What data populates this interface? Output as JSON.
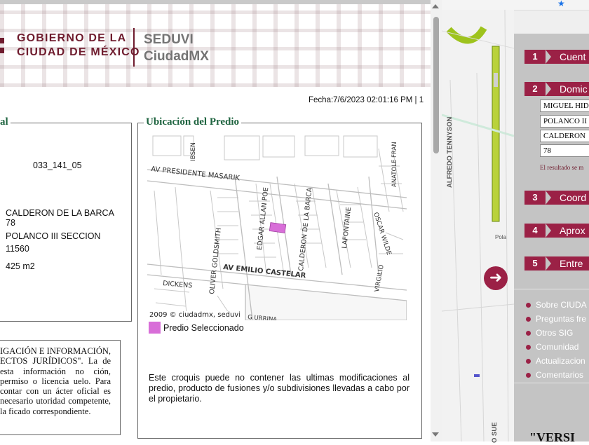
{
  "popup": {
    "header": {
      "gov_line1": "GOBIERNO DE LA",
      "gov_line2": "CIUDAD DE MÉXICO",
      "seduvi_line1": "SEDUVI",
      "seduvi_line2": "CiudadMX"
    },
    "fecha": "Fecha:7/6/2023 02:01:16 PM | 1",
    "left_section": {
      "legend": "al",
      "cuenta_catastral": "033_141_05",
      "calle": "CALDERON DE LA BARCA",
      "numero": "78",
      "colonia": "POLANCO III SECCION",
      "codigo_postal": "11560",
      "superficie": "425 m2",
      "legal_text": "IGACIÓN E INFORMACIÓN, ECTOS JURÍDICOS\". La de esta información no ción, permiso o licencia uelo. Para contar con un ácter oficial es necesario utoridad competente, la ficado correspondiente."
    },
    "right_section": {
      "legend": "Ubicación del Predio",
      "map_credit": "2009 © ciudadmx, seduvi",
      "map_streets": {
        "presidente_masarik": "AV PRESIDENTE MASARIK",
        "emilio_castelar": "AV EMILIO CASTELAR",
        "ibsen": "IBSEN",
        "oliver_goldsmith": "OLIVER GOLDSMITH",
        "edgar_allan_poe": "EDGAR ALLAN POE",
        "calderon": "CALDERON DE LA BARCA",
        "lafontaine": "LAFONTAINE",
        "oscar_wilde": "OSCAR WILDE",
        "anatole": "ANATOLE FRAN",
        "dickens": "DICKENS",
        "virgilio": "VIRGILIO",
        "urrina": "G URRINA"
      },
      "legend_label": "Predio Seleccionado",
      "disclaimer": "Este croquis puede no contener las ultimas modificaciones al predio, producto de fusiones y/o subdivisiones llevadas a cabo por el propietario."
    }
  },
  "background_page": {
    "map_labels": {
      "tennyson": "ALFREDO TENNYSON",
      "pola": "Pola",
      "sue": "O SUE"
    },
    "steps": [
      {
        "num": "1",
        "label": "Cuent"
      },
      {
        "num": "2",
        "label": "Domic"
      },
      {
        "num": "3",
        "label": "Coord"
      },
      {
        "num": "4",
        "label": "Aprox"
      },
      {
        "num": "5",
        "label": "Entre"
      }
    ],
    "address_inputs": [
      "MIGUEL HID",
      "POLANCO II",
      "CALDERON",
      "78"
    ],
    "result_note": "El resultado se m",
    "links": [
      "Sobre CIUDA",
      "Preguntas fre",
      "Otros SIG",
      "Comunidad",
      "Actualizacion",
      "Comentarios"
    ],
    "version_text": "\"VERSI"
  },
  "colors": {
    "brand_maroon": "#9b2146",
    "legend_green": "#1f6440",
    "predio_magenta": "#d86ed8"
  }
}
